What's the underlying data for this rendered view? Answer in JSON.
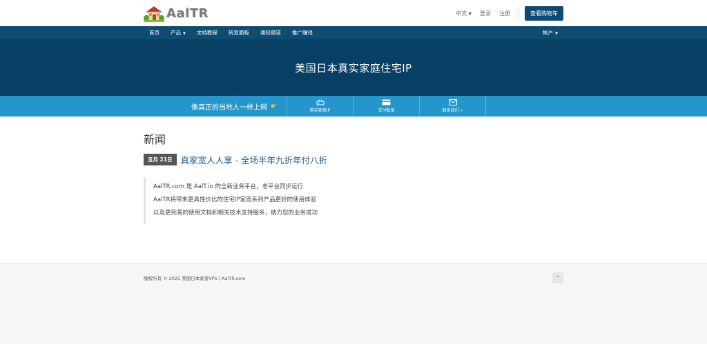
{
  "header": {
    "logo_text": "AalTR",
    "language": "中文",
    "login": "登录",
    "register": "注册",
    "cart_button": "查看购物车"
  },
  "nav": {
    "items": [
      {
        "label": "首页"
      },
      {
        "label": "产品"
      },
      {
        "label": "文档教程"
      },
      {
        "label": "转发面板"
      },
      {
        "label": "通知频道"
      },
      {
        "label": "推广赚钱"
      }
    ],
    "account": "帐户"
  },
  "banner": {
    "title": "美国日本真实家庭住宅IP"
  },
  "strip": {
    "slogan": "像真正的当地人一样上网",
    "items": [
      {
        "label": "购买家宽IP",
        "icon": "router-icon"
      },
      {
        "label": "支付账单",
        "icon": "credit-card-icon"
      },
      {
        "label": "联系我们 »",
        "icon": "envelope-icon"
      }
    ]
  },
  "main": {
    "title": "新闻",
    "news": {
      "date": "五月 21日",
      "headline": "真家宽人人享 - 全场半年九折年付八折",
      "lines": [
        "AalTR.com 是 AalT.io 的全新业务平台，老平台同步运行",
        "AalTR将带来更具性价比的住宅IP家宽系列产品更好的使用体验",
        "以及更完善的使用文档和相关技术支持服务，助力您的业务成功"
      ]
    }
  },
  "footer": {
    "copyright": "版权所有 © 2025 美国日本家宽VPS | AalTR.com"
  },
  "colors": {
    "nav_bg": "#0e4d73",
    "banner_bg": "#083f65",
    "strip_bg": "#2496cb",
    "link": "#1f5c8a"
  }
}
